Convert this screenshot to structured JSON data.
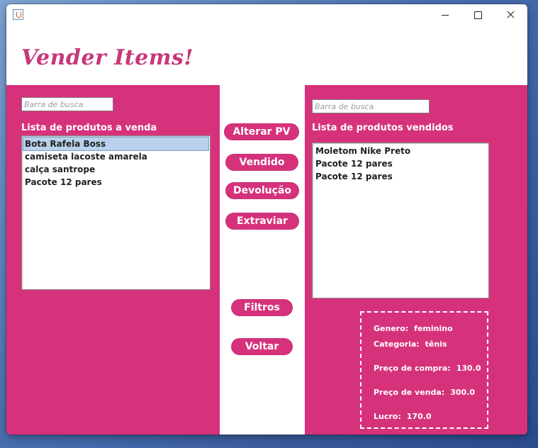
{
  "window": {
    "controls": {
      "minimize_icon": "minimize-icon",
      "maximize_icon": "maximize-icon",
      "close_icon": "close-icon"
    }
  },
  "header": {
    "title": "Vender Items!"
  },
  "colors": {
    "accent": "#d6327c",
    "heading": "#c7377a",
    "selected": "#b9d1ea"
  },
  "left_panel": {
    "search_placeholder": "Barra de busca",
    "list_title": "Lista de produtos a venda",
    "items": [
      "Bota Rafela Boss",
      "camiseta lacoste amarela",
      "calça santrope",
      "Pacote 12 pares"
    ],
    "selected_index": 0
  },
  "actions": {
    "alterar_pv": "Alterar PV",
    "vendido": "Vendido",
    "devolucao": "Devolução",
    "extraviar": "Extraviar",
    "filtros": "Filtros",
    "voltar": "Voltar"
  },
  "right_panel": {
    "search_placeholder": "Barra de busca",
    "list_title": "Lista de produtos vendidos",
    "items": [
      "Moletom Nike Preto",
      "Pacote 12 pares",
      "Pacote 12 pares"
    ]
  },
  "details": {
    "genero": {
      "label": "Genero:",
      "value": "feminino"
    },
    "categoria": {
      "label": "Categoria:",
      "value": "tênis"
    },
    "preco_compra": {
      "label": "Preço de compra:",
      "value": "130.0"
    },
    "preco_venda": {
      "label": "Preço de venda:",
      "value": "300.0"
    },
    "lucro": {
      "label": "Lucro:",
      "value": "170.0"
    }
  }
}
